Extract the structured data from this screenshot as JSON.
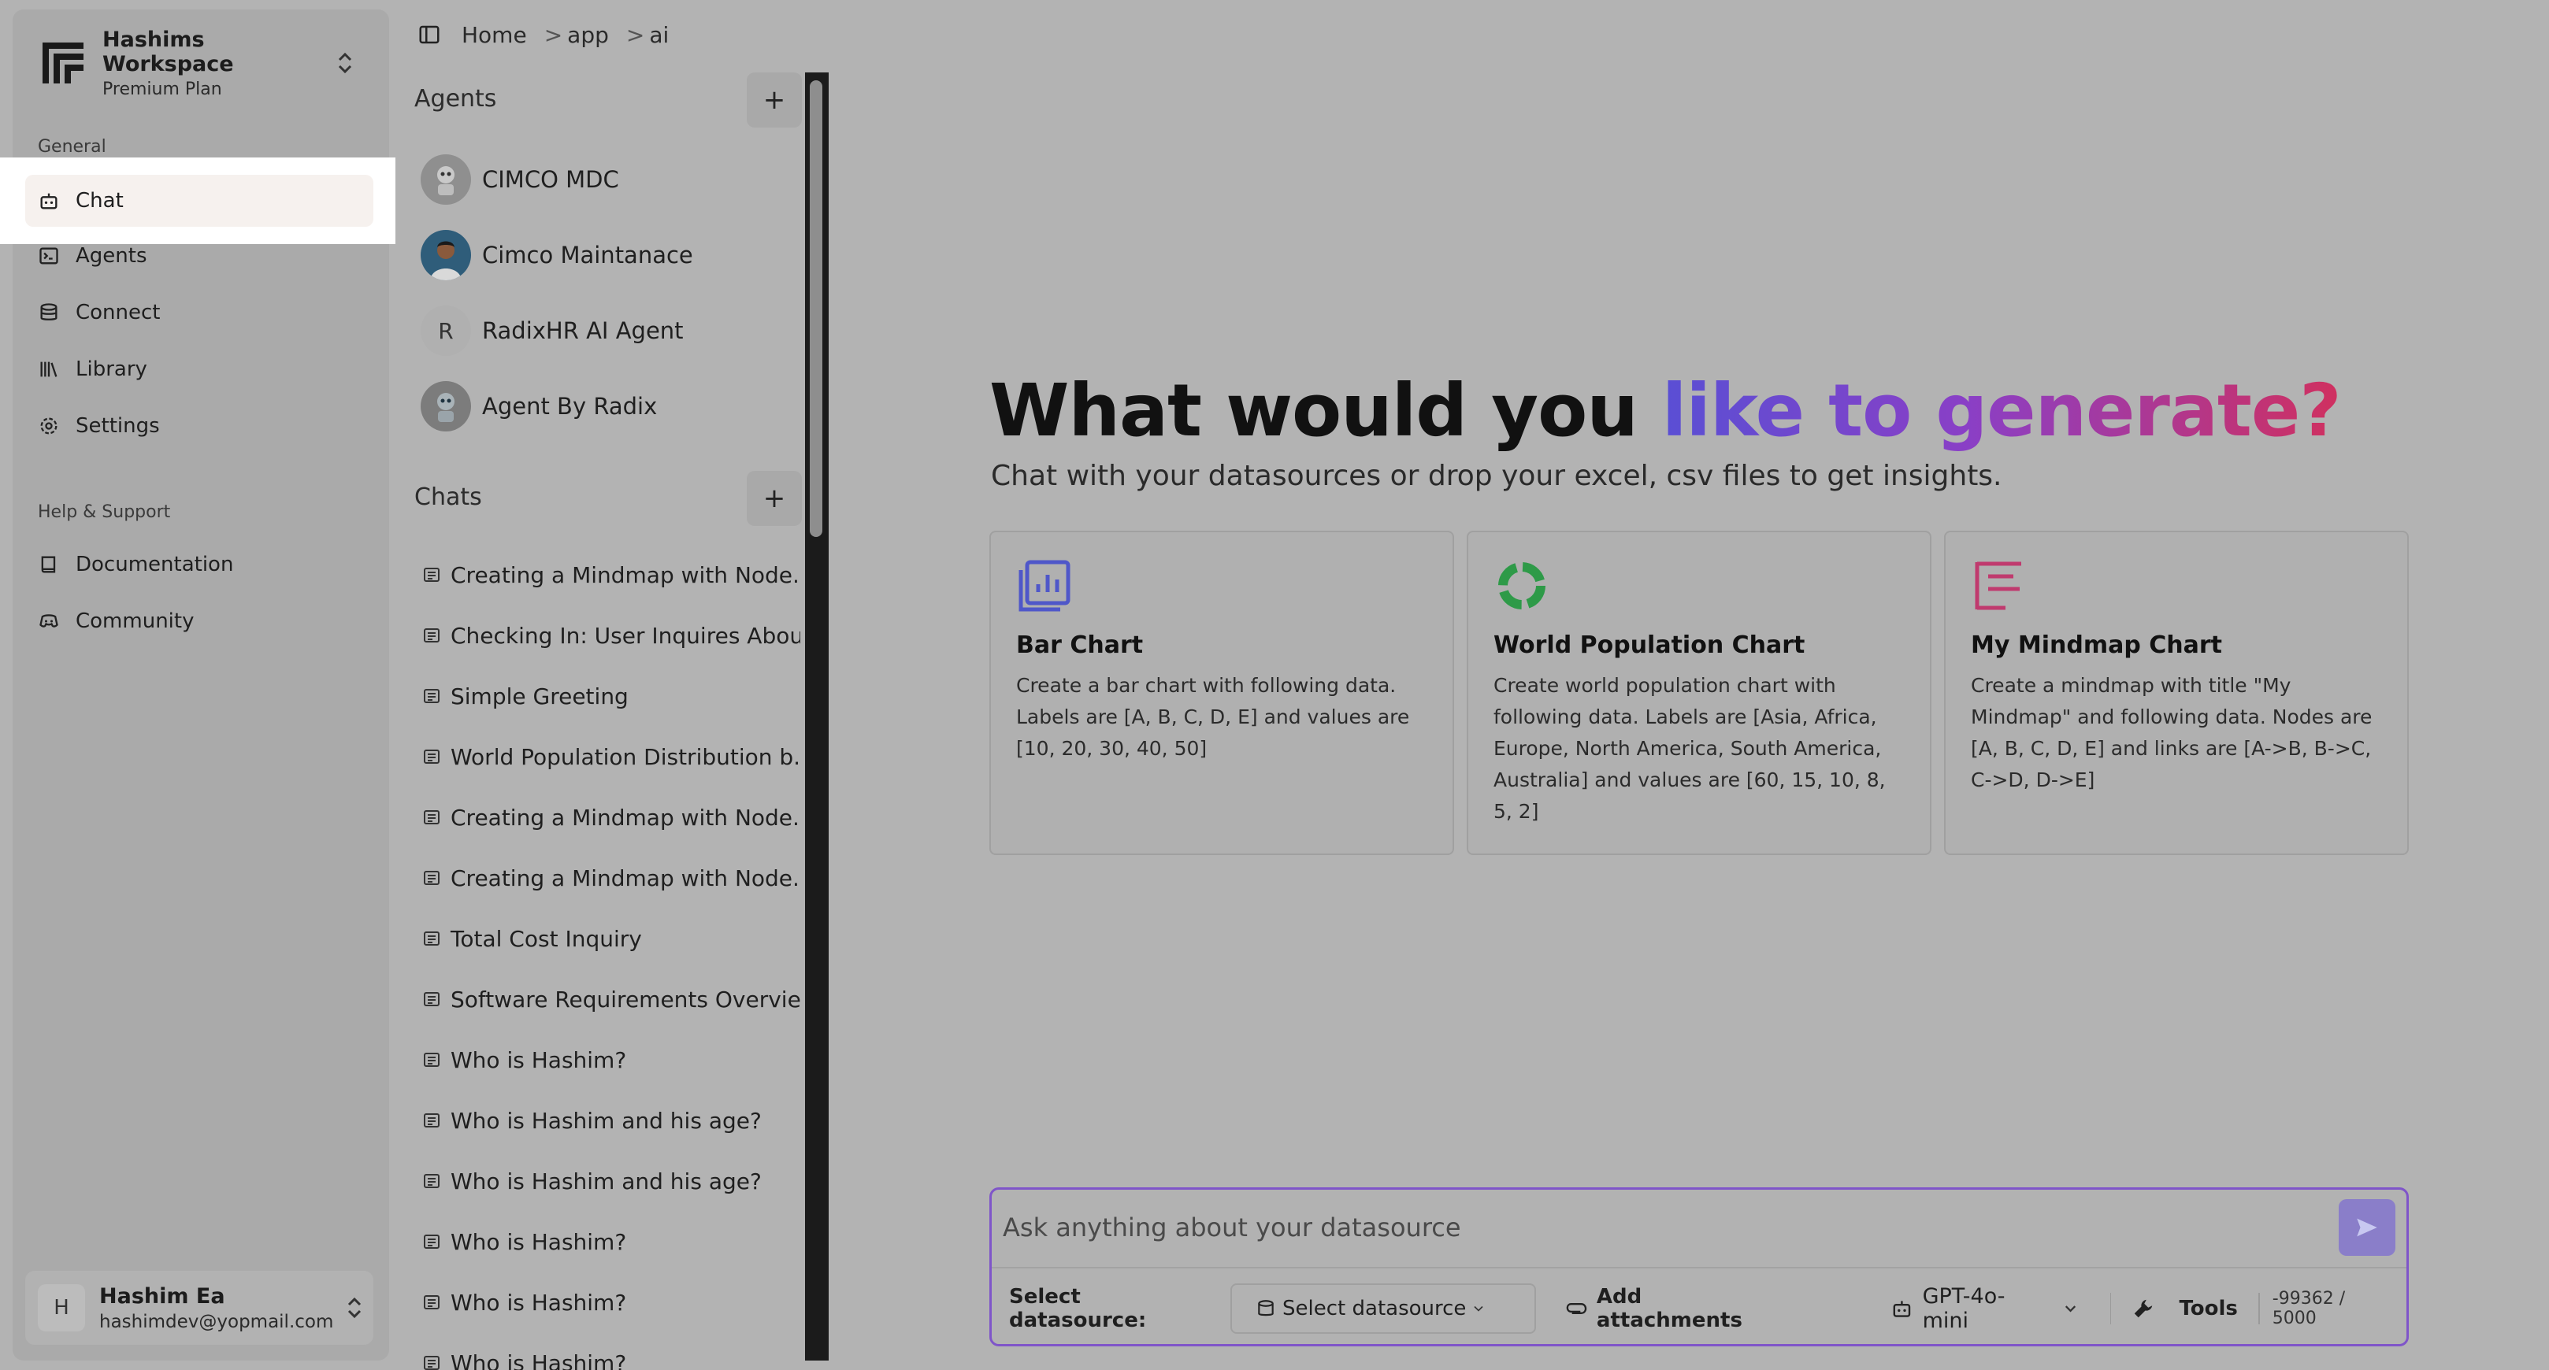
{
  "workspace": {
    "name": "Hashims Workspace",
    "plan": "Premium Plan"
  },
  "nav": {
    "general_label": "General",
    "items": [
      {
        "label": "Chat"
      },
      {
        "label": "Agents"
      },
      {
        "label": "Connect"
      },
      {
        "label": "Library"
      },
      {
        "label": "Settings"
      }
    ],
    "help_label": "Help & Support",
    "help_items": [
      {
        "label": "Documentation"
      },
      {
        "label": "Community"
      }
    ]
  },
  "user": {
    "initial": "H",
    "name": "Hashim Ea",
    "email": "hashimdev@yopmail.com"
  },
  "breadcrumb": {
    "items": [
      "Home",
      "app",
      "ai"
    ],
    "separator": ">"
  },
  "agents_panel": {
    "title": "Agents",
    "add": "+",
    "agents": [
      {
        "name": "CIMCO MDC",
        "avatar": "robot-avatar"
      },
      {
        "name": "Cimco Maintanace",
        "avatar": "person-avatar"
      },
      {
        "name": "RadixHR AI Agent",
        "avatar_letter": "R"
      },
      {
        "name": "Agent By Radix",
        "avatar": "robot-avatar"
      }
    ]
  },
  "chats_panel": {
    "title": "Chats",
    "add": "+",
    "chats": [
      "Creating a Mindmap with Node...",
      "Checking In: User Inquires Abou...",
      "Simple Greeting",
      "World Population Distribution b...",
      "Creating a Mindmap with Node...",
      "Creating a Mindmap with Node...",
      "Total Cost Inquiry",
      "Software Requirements Overview",
      "Who is Hashim?",
      "Who is Hashim and his age?",
      "Who is Hashim and his age?",
      "Who is Hashim?",
      "Who is Hashim?",
      "Who is Hashim?"
    ]
  },
  "hero": {
    "title_plain": "What would you ",
    "title_gradient": "like to generate?",
    "subtitle": "Chat with your datasources or drop your excel, csv files to get insights."
  },
  "cards": [
    {
      "title": "Bar Chart",
      "desc": "Create a bar chart with following data. Labels are [A, B, C, D, E] and values are [10, 20, 30, 40, 50]",
      "icon": "bar-chart-icon",
      "color": "#4f57c9"
    },
    {
      "title": "World Population Chart",
      "desc": "Create world population chart with following data. Labels are [Asia, Africa, Europe, North America, South America, Australia] and values are [60, 15, 10, 8, 5, 2]",
      "icon": "donut-chart-icon",
      "color": "#2e9a48"
    },
    {
      "title": "My Mindmap Chart",
      "desc": "Create a mindmap with title \"My Mindmap\" and following data. Nodes are [A, B, C, D, E] and links are [A->B, B->C, C->D, D->E]",
      "icon": "mindmap-icon",
      "color": "#c03a6e"
    }
  ],
  "composer": {
    "placeholder": "Ask anything about your datasource",
    "datasource_label": "Select datasource:",
    "datasource_select": "Select datasource",
    "attachments": "Add attachments",
    "model": "GPT-4o-mini",
    "tools": "Tools",
    "counter": "-99362 / 5000"
  }
}
